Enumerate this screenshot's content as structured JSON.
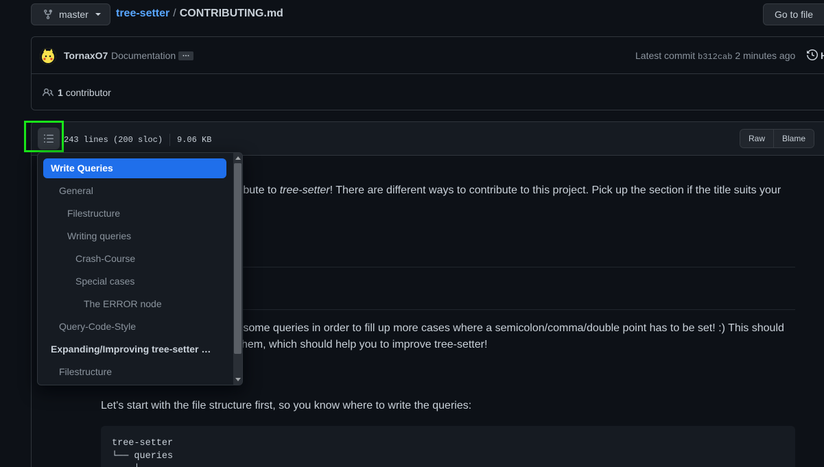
{
  "header": {
    "branch": "master",
    "repo": "tree-setter",
    "separator": "/",
    "file": "CONTRIBUTING.md",
    "goto_file": "Go to file"
  },
  "commit": {
    "author": "TornaxO7",
    "message": "Documentation",
    "ellipsis": "…",
    "latest_label": "Latest commit",
    "sha": "b312cab",
    "time": "2 minutes ago",
    "history_label": "H"
  },
  "contributors": {
    "count": "1",
    "label": "contributor"
  },
  "file_info": {
    "lines": "243 lines (200 sloc)",
    "size": "9.06 KB",
    "raw": "Raw",
    "blame": "Blame"
  },
  "content": {
    "intro_visible": "tribute to ",
    "intro_em": "tree-setter",
    "intro_rest": "! There are different ways to contribute to this project. Pick up the section if the title suits your",
    "para1_line1": "e some queries in order to fill up more cases where a semicolon/comma/double point has to be set! :) This should",
    "para1_line2": "hem, which should help you to improve tree-setter!",
    "para2": "Let's start with the file structure first, so you know where to write the queries:",
    "code_line1": "tree-setter",
    "code_line2": "└── queries",
    "code_line3": "    ├"
  },
  "toc": {
    "items": [
      {
        "label": "Write Queries"
      },
      {
        "label": "General"
      },
      {
        "label": "Filestructure"
      },
      {
        "label": "Writing queries"
      },
      {
        "label": "Crash-Course"
      },
      {
        "label": "Special cases"
      },
      {
        "label": "The ERROR node"
      },
      {
        "label": "Query-Code-Style"
      },
      {
        "label": "Expanding/Improving tree-setter …"
      },
      {
        "label": "Filestructure"
      }
    ]
  },
  "colors": {
    "background": "#0d1117",
    "accent": "#1f6feb",
    "link": "#58a6ff",
    "highlight": "#19e619"
  }
}
